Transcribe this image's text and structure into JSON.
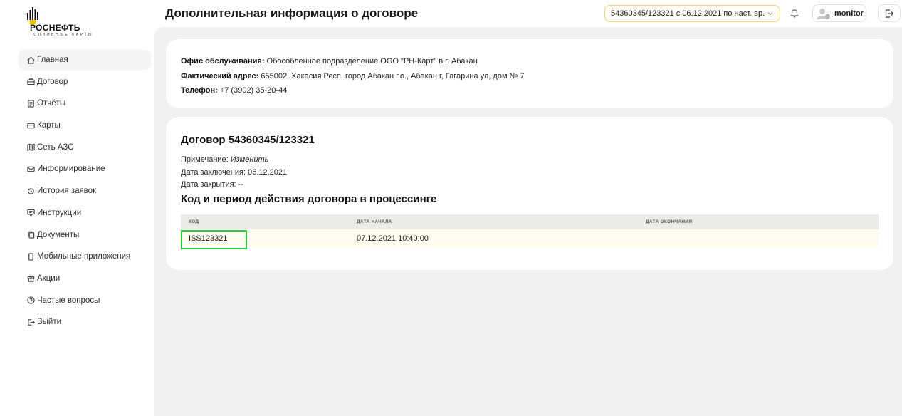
{
  "brand": {
    "name": "РОСНЕФТЬ",
    "tagline": "ТОПЛИВНЫЕ КАРТЫ"
  },
  "header": {
    "title": "Дополнительная информация о договоре",
    "contract_select": "54360345/123321 с 06.12.2021 по наст. вр.",
    "user": "monitor"
  },
  "sidebar": {
    "items": [
      {
        "label": "Главная",
        "icon": "home-icon"
      },
      {
        "label": "Договор",
        "icon": "briefcase-icon"
      },
      {
        "label": "Отчёты",
        "icon": "report-icon"
      },
      {
        "label": "Карты",
        "icon": "card-icon"
      },
      {
        "label": "Сеть АЗС",
        "icon": "map-icon"
      },
      {
        "label": "Информирование",
        "icon": "mail-icon"
      },
      {
        "label": "История заявок",
        "icon": "history-icon"
      },
      {
        "label": "Инструкции",
        "icon": "instructions-icon"
      },
      {
        "label": "Документы",
        "icon": "documents-icon"
      },
      {
        "label": "Мобильные приложения",
        "icon": "phone-icon"
      },
      {
        "label": "Акции",
        "icon": "gift-icon"
      },
      {
        "label": "Частые вопросы",
        "icon": "question-icon"
      },
      {
        "label": "Выйти",
        "icon": "logout-icon"
      }
    ]
  },
  "office": {
    "office_label": "Офис обслуживания:",
    "office_value": "Обособленное подразделение ООО \"РН-Карт\" в г. Абакан",
    "address_label": "Фактический адрес:",
    "address_value": "655002, Хакасия Респ, город Абакан г.о., Абакан г, Гагарина ул, дом № 7",
    "phone_label": "Телефон:",
    "phone_value": "+7 (3902) 35-20-44"
  },
  "contract": {
    "title": "Договор 54360345/123321",
    "note_label": "Примечание:",
    "note_link": "Изменить",
    "date_signed": "Дата заключения: 06.12.2021",
    "date_closed": "Дата закрытия: --",
    "section_title": "Код и период действия договора в процессинге",
    "table": {
      "headers": [
        "КОД",
        "ДАТА НАЧАЛА",
        "ДАТА ОКОНЧАНИЯ"
      ],
      "rows": [
        [
          "ISS123321",
          "07.12.2021 10:40:00",
          ""
        ]
      ]
    }
  },
  "colors": {
    "accent_yellow": "#f3d27a",
    "highlight_green": "#22d13a",
    "main_bg": "#f1f1f1",
    "row_bg": "#fffbee"
  }
}
